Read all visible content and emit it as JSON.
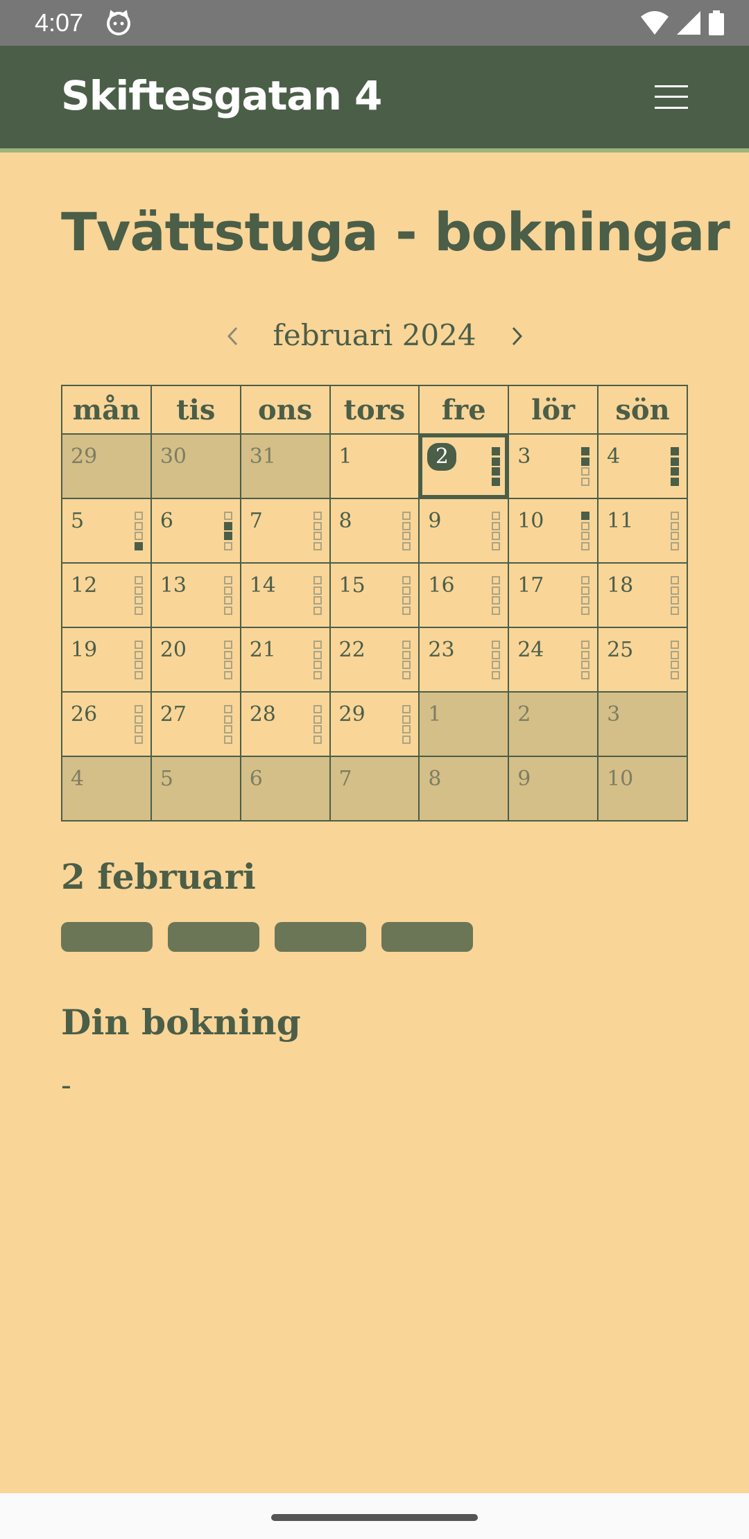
{
  "status": {
    "time": "4:07"
  },
  "header": {
    "brand": "Skiftesgatan 4"
  },
  "page": {
    "title": "Tvättstuga - bokningar"
  },
  "calendar": {
    "month_label": "februari 2024",
    "weekdays": [
      "mån",
      "tis",
      "ons",
      "tors",
      "fre",
      "lör",
      "sön"
    ],
    "selected_day": "2",
    "weeks": [
      [
        {
          "d": "29",
          "other": true,
          "slots": []
        },
        {
          "d": "30",
          "other": true,
          "slots": []
        },
        {
          "d": "31",
          "other": true,
          "slots": []
        },
        {
          "d": "1",
          "other": false,
          "slots": []
        },
        {
          "d": "2",
          "other": false,
          "selected": true,
          "slots": [
            1,
            1,
            1,
            1
          ]
        },
        {
          "d": "3",
          "other": false,
          "slots": [
            1,
            1,
            0,
            0
          ]
        },
        {
          "d": "4",
          "other": false,
          "slots": [
            1,
            1,
            1,
            1
          ]
        }
      ],
      [
        {
          "d": "5",
          "other": false,
          "slots": [
            0,
            0,
            0,
            1
          ]
        },
        {
          "d": "6",
          "other": false,
          "slots": [
            0,
            1,
            1,
            0
          ]
        },
        {
          "d": "7",
          "other": false,
          "slots": [
            0,
            0,
            0,
            0
          ]
        },
        {
          "d": "8",
          "other": false,
          "slots": [
            0,
            0,
            0,
            0
          ]
        },
        {
          "d": "9",
          "other": false,
          "slots": [
            0,
            0,
            0,
            0
          ]
        },
        {
          "d": "10",
          "other": false,
          "slots": [
            1,
            0,
            0,
            0
          ]
        },
        {
          "d": "11",
          "other": false,
          "slots": [
            0,
            0,
            0,
            0
          ]
        }
      ],
      [
        {
          "d": "12",
          "other": false,
          "slots": [
            0,
            0,
            0,
            0
          ]
        },
        {
          "d": "13",
          "other": false,
          "slots": [
            0,
            0,
            0,
            0
          ]
        },
        {
          "d": "14",
          "other": false,
          "slots": [
            0,
            0,
            0,
            0
          ]
        },
        {
          "d": "15",
          "other": false,
          "slots": [
            0,
            0,
            0,
            0
          ]
        },
        {
          "d": "16",
          "other": false,
          "slots": [
            0,
            0,
            0,
            0
          ]
        },
        {
          "d": "17",
          "other": false,
          "slots": [
            0,
            0,
            0,
            0
          ]
        },
        {
          "d": "18",
          "other": false,
          "slots": [
            0,
            0,
            0,
            0
          ]
        }
      ],
      [
        {
          "d": "19",
          "other": false,
          "slots": [
            0,
            0,
            0,
            0
          ]
        },
        {
          "d": "20",
          "other": false,
          "slots": [
            0,
            0,
            0,
            0
          ]
        },
        {
          "d": "21",
          "other": false,
          "slots": [
            0,
            0,
            0,
            0
          ]
        },
        {
          "d": "22",
          "other": false,
          "slots": [
            0,
            0,
            0,
            0
          ]
        },
        {
          "d": "23",
          "other": false,
          "slots": [
            0,
            0,
            0,
            0
          ]
        },
        {
          "d": "24",
          "other": false,
          "slots": [
            0,
            0,
            0,
            0
          ]
        },
        {
          "d": "25",
          "other": false,
          "slots": [
            0,
            0,
            0,
            0
          ]
        }
      ],
      [
        {
          "d": "26",
          "other": false,
          "slots": [
            0,
            0,
            0,
            0
          ]
        },
        {
          "d": "27",
          "other": false,
          "slots": [
            0,
            0,
            0,
            0
          ]
        },
        {
          "d": "28",
          "other": false,
          "slots": [
            0,
            0,
            0,
            0
          ]
        },
        {
          "d": "29",
          "other": false,
          "slots": [
            0,
            0,
            0,
            0
          ]
        },
        {
          "d": "1",
          "other": true,
          "slots": []
        },
        {
          "d": "2",
          "other": true,
          "slots": []
        },
        {
          "d": "3",
          "other": true,
          "slots": []
        }
      ],
      [
        {
          "d": "4",
          "other": true,
          "slots": []
        },
        {
          "d": "5",
          "other": true,
          "slots": []
        },
        {
          "d": "6",
          "other": true,
          "slots": []
        },
        {
          "d": "7",
          "other": true,
          "slots": []
        },
        {
          "d": "8",
          "other": true,
          "slots": []
        },
        {
          "d": "9",
          "other": true,
          "slots": []
        },
        {
          "d": "10",
          "other": true,
          "slots": []
        }
      ]
    ]
  },
  "day_panel": {
    "heading": "2 februari",
    "slot_count": 4
  },
  "my_booking": {
    "heading": "Din bokning",
    "value": "-"
  },
  "colors": {
    "background": "#f9d598",
    "primary": "#4b5f48",
    "accent_line": "#9cb47c",
    "muted_cell": "#d4bf88",
    "pill": "#6b7656"
  },
  "icons": {
    "status_app": "cat-face-icon",
    "wifi": "wifi-icon",
    "signal": "signal-icon",
    "battery": "battery-icon",
    "menu": "hamburger-menu-icon",
    "prev": "chevron-left-icon",
    "next": "chevron-right-icon"
  }
}
